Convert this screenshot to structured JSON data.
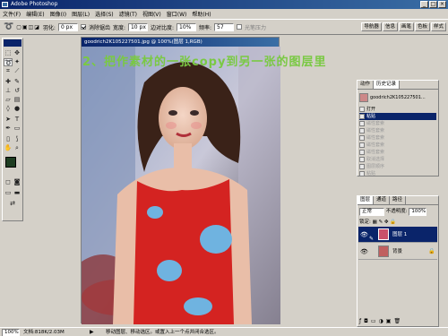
{
  "app": {
    "title": "Adobe Photoshop"
  },
  "menu": [
    "文件(F)",
    "编辑(E)",
    "图像(I)",
    "图层(L)",
    "选择(S)",
    "滤镜(T)",
    "视图(V)",
    "窗口(W)",
    "帮助(H)"
  ],
  "options": {
    "feather_label": "羽化:",
    "feather_value": "0 px",
    "antialias_label": "消除锯齿",
    "width_label": "宽度:",
    "width_value": "10 px",
    "edge_label": "边对比度:",
    "edge_value": "10%",
    "freq_label": "频率:",
    "freq_value": "57",
    "pen_label": "光笔压力",
    "tabs": [
      "导航器",
      "信息",
      "画笔",
      "色板",
      "样式"
    ]
  },
  "document": {
    "title": "goodrich2K105227501.jpg @ 100%(图层 1,RGB)"
  },
  "instruction": "2、把作素材的一张copy到另一张的图层里",
  "history": {
    "tabs": [
      "动作",
      "历史记录"
    ],
    "snapshot": "goodrich2K105227501...",
    "items": [
      "打开",
      "粘贴",
      "磁性套索",
      "磁性套索",
      "磁性套索",
      "磁性套索",
      "磁性套索",
      "取消选择",
      "图层顺序",
      "粘贴"
    ]
  },
  "layers": {
    "tabs": [
      "图层",
      "通道",
      "路径"
    ],
    "mode": "正常",
    "opacity_label": "不透明度:",
    "opacity_value": "100%",
    "lock_label": "锁定:",
    "rows": [
      {
        "name": "图层 1"
      },
      {
        "name": "背景"
      }
    ]
  },
  "status": {
    "zoom": "100%",
    "doc": "文档:818K/2.03M",
    "message": "移动图层、移动选区。或置入上一个点并闭合选区。"
  }
}
